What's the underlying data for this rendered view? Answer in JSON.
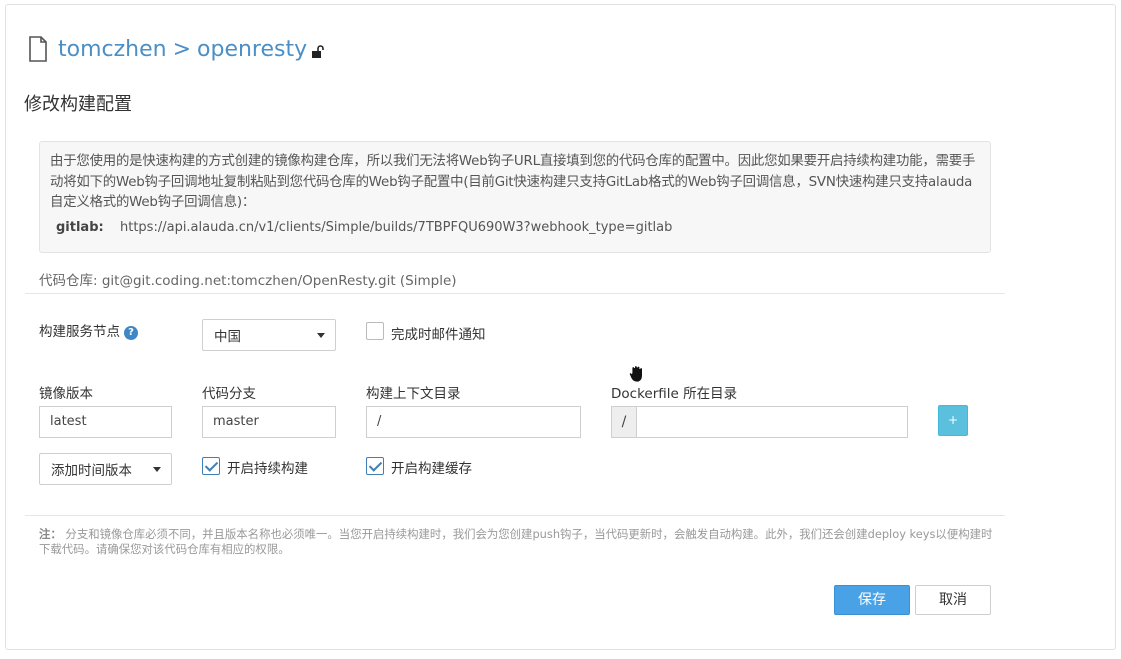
{
  "breadcrumb": {
    "user": "tomczhen",
    "separator": ">",
    "repo": "openresty"
  },
  "page_title": "修改构建配置",
  "info": {
    "text": "由于您使用的是快速构建的方式创建的镜像构建仓库，所以我们无法将Web钩子URL直接填到您的代码仓库的配置中。因此您如果要开启持续构建功能，需要手动将如下的Web钩子回调地址复制粘贴到您代码仓库的Web钩子配置中(目前Git快速构建只支持GitLab格式的Web钩子回调信息，SVN快速构建只支持alauda自定义格式的Web钩子回调信息)：",
    "url_label": "gitlab:",
    "url": "https://api.alauda.cn/v1/clients/Simple/builds/7TBPFQU690W3?webhook_type=gitlab"
  },
  "repo": {
    "label": "代码仓库:",
    "value": "git@git.coding.net:tomczhen/OpenResty.git (Simple)"
  },
  "form": {
    "node_label": "构建服务节点",
    "node_help": "?",
    "node_value": "中国",
    "email_notify_label": "完成时邮件通知",
    "image_version_label": "镜像版本",
    "image_version_value": "latest",
    "branch_label": "代码分支",
    "branch_value": "master",
    "context_dir_label": "构建上下文目录",
    "context_dir_value": "/",
    "dockerfile_dir_label": "Dockerfile 所在目录",
    "dockerfile_prefix": "/",
    "dockerfile_dir_value": "",
    "plus_label": "+",
    "version_select_value": "添加时间版本",
    "continuous_build_label": "开启持续构建",
    "build_cache_label": "开启构建缓存"
  },
  "note": {
    "prefix": "注：",
    "text": "分支和镜像仓库必须不同，并且版本名称也必须唯一。当您开启持续构建时，我们会为您创建push钩子，当代码更新时，会触发自动构建。此外，我们还会创建deploy keys以便构建时下载代码。请确保您对该代码仓库有相应的权限。"
  },
  "buttons": {
    "save": "保存",
    "cancel": "取消"
  }
}
